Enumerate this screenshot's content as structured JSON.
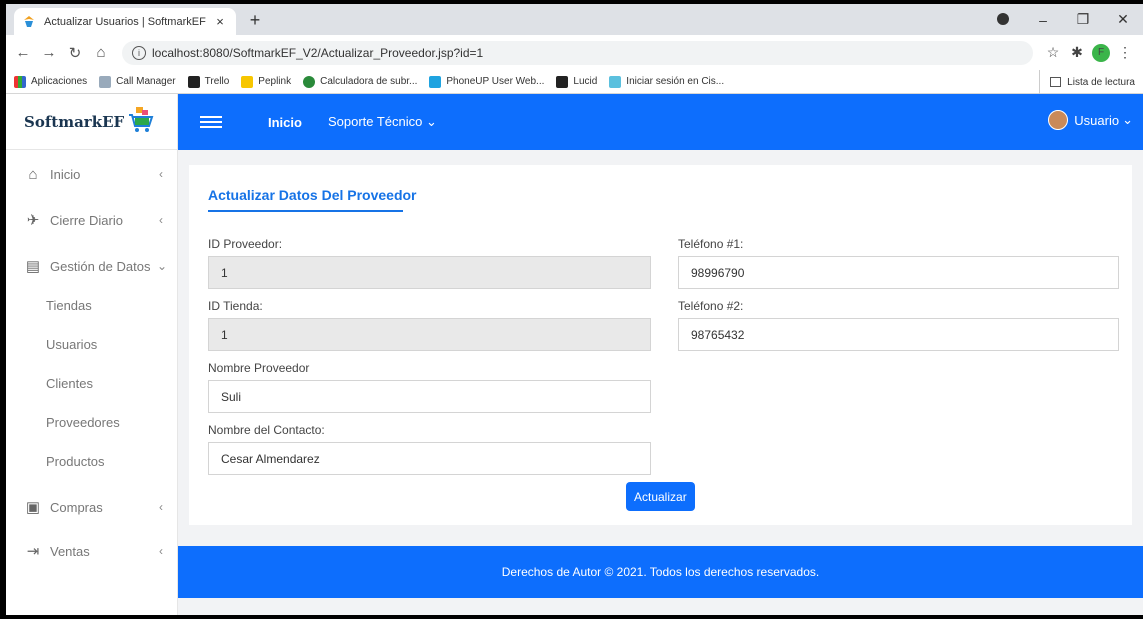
{
  "browser": {
    "tab_title": "Actualizar Usuarios | SoftmarkEF",
    "url": "localhost:8080/SoftmarkEF_V2/Actualizar_Proveedor.jsp?id=1",
    "profile_initial": "F",
    "bookmarks": [
      "Aplicaciones",
      "Call Manager",
      "Trello",
      "Peplink",
      "Calculadora de subr...",
      "PhoneUP User Web...",
      "Lucid",
      "Iniciar sesión en Cis..."
    ],
    "reading_list": "Lista de lectura"
  },
  "brand": {
    "name": "SoftmarkEF"
  },
  "sidebar": {
    "items": [
      {
        "label": "Inicio"
      },
      {
        "label": "Cierre Diario"
      },
      {
        "label": "Gestión de Datos"
      },
      {
        "label": "Compras"
      },
      {
        "label": "Ventas"
      }
    ],
    "subitems": [
      "Tiendas",
      "Usuarios",
      "Clientes",
      "Proveedores",
      "Productos"
    ]
  },
  "topbar": {
    "inicio": "Inicio",
    "soporte": "Soporte Técnico",
    "user": "Usuario"
  },
  "form": {
    "title": "Actualizar Datos Del Proveedor",
    "id_proveedor_label": "ID Proveedor:",
    "id_proveedor_value": "1",
    "id_tienda_label": "ID Tienda:",
    "id_tienda_value": "1",
    "nombre_proveedor_label": "Nombre Proveedor",
    "nombre_proveedor_value": "Suli",
    "nombre_contacto_label": "Nombre del Contacto:",
    "nombre_contacto_value": "Cesar Almendarez",
    "telefono1_label": "Teléfono #1:",
    "telefono1_value": "98996790",
    "telefono2_label": "Teléfono #2:",
    "telefono2_value": "98765432",
    "submit_label": "Actualizar"
  },
  "footer": {
    "text": "Derechos de Autor © 2021. Todos los derechos reservados."
  },
  "colors": {
    "primary": "#0d6efd",
    "title_blue": "#1673e6",
    "content_bg": "#f2f3f5"
  }
}
